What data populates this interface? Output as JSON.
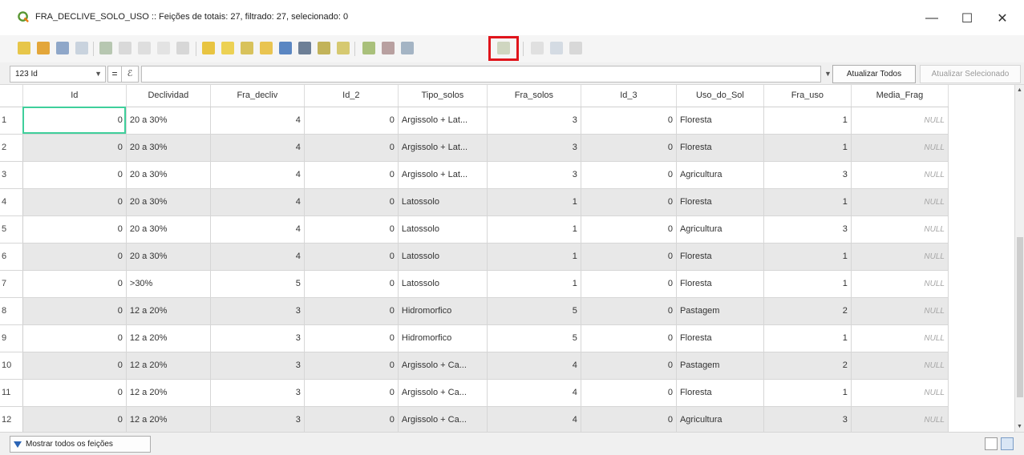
{
  "window": {
    "title": "FRA_DECLIVE_SOLO_USO :: Feições de totais: 27, filtrado: 27, selecionado: 0",
    "minimize": "—",
    "maximize": "☐",
    "close": "✕"
  },
  "filter": {
    "field_label": "123 Id",
    "eq_symbol": "=",
    "expr_symbol": "ℰ",
    "update_all": "Atualizar Todos",
    "update_selected": "Atualizar Selecionado"
  },
  "columns": [
    "Id",
    "Declividad",
    "Fra_decliv",
    "Id_2",
    "Tipo_solos",
    "Fra_solos",
    "Id_3",
    "Uso_do_Sol",
    "Fra_uso",
    "Media_Frag"
  ],
  "rows": [
    {
      "n": "1",
      "id": "0",
      "declividad": "20 a 30%",
      "fra_decliv": "4",
      "id_2": "0",
      "tipo_solos": "Argissolo + Lat...",
      "fra_solos": "3",
      "id_3": "0",
      "uso_do_sol": "Floresta",
      "fra_uso": "1",
      "media_frag": "NULL"
    },
    {
      "n": "2",
      "id": "0",
      "declividad": "20 a 30%",
      "fra_decliv": "4",
      "id_2": "0",
      "tipo_solos": "Argissolo + Lat...",
      "fra_solos": "3",
      "id_3": "0",
      "uso_do_sol": "Floresta",
      "fra_uso": "1",
      "media_frag": "NULL"
    },
    {
      "n": "3",
      "id": "0",
      "declividad": "20 a 30%",
      "fra_decliv": "4",
      "id_2": "0",
      "tipo_solos": "Argissolo + Lat...",
      "fra_solos": "3",
      "id_3": "0",
      "uso_do_sol": "Agricultura",
      "fra_uso": "3",
      "media_frag": "NULL"
    },
    {
      "n": "4",
      "id": "0",
      "declividad": "20 a 30%",
      "fra_decliv": "4",
      "id_2": "0",
      "tipo_solos": "Latossolo",
      "fra_solos": "1",
      "id_3": "0",
      "uso_do_sol": "Floresta",
      "fra_uso": "1",
      "media_frag": "NULL"
    },
    {
      "n": "5",
      "id": "0",
      "declividad": "20 a 30%",
      "fra_decliv": "4",
      "id_2": "0",
      "tipo_solos": "Latossolo",
      "fra_solos": "1",
      "id_3": "0",
      "uso_do_sol": "Agricultura",
      "fra_uso": "3",
      "media_frag": "NULL"
    },
    {
      "n": "6",
      "id": "0",
      "declividad": "20 a 30%",
      "fra_decliv": "4",
      "id_2": "0",
      "tipo_solos": "Latossolo",
      "fra_solos": "1",
      "id_3": "0",
      "uso_do_sol": "Floresta",
      "fra_uso": "1",
      "media_frag": "NULL"
    },
    {
      "n": "7",
      "id": "0",
      "declividad": ">30%",
      "fra_decliv": "5",
      "id_2": "0",
      "tipo_solos": "Latossolo",
      "fra_solos": "1",
      "id_3": "0",
      "uso_do_sol": "Floresta",
      "fra_uso": "1",
      "media_frag": "NULL"
    },
    {
      "n": "8",
      "id": "0",
      "declividad": "12 a 20%",
      "fra_decliv": "3",
      "id_2": "0",
      "tipo_solos": "Hidromorfico",
      "fra_solos": "5",
      "id_3": "0",
      "uso_do_sol": "Pastagem",
      "fra_uso": "2",
      "media_frag": "NULL"
    },
    {
      "n": "9",
      "id": "0",
      "declividad": "12 a 20%",
      "fra_decliv": "3",
      "id_2": "0",
      "tipo_solos": "Hidromorfico",
      "fra_solos": "5",
      "id_3": "0",
      "uso_do_sol": "Floresta",
      "fra_uso": "1",
      "media_frag": "NULL"
    },
    {
      "n": "10",
      "id": "0",
      "declividad": "12 a 20%",
      "fra_decliv": "3",
      "id_2": "0",
      "tipo_solos": "Argissolo + Ca...",
      "fra_solos": "4",
      "id_3": "0",
      "uso_do_sol": "Pastagem",
      "fra_uso": "2",
      "media_frag": "NULL"
    },
    {
      "n": "11",
      "id": "0",
      "declividad": "12 a 20%",
      "fra_decliv": "3",
      "id_2": "0",
      "tipo_solos": "Argissolo + Ca...",
      "fra_solos": "4",
      "id_3": "0",
      "uso_do_sol": "Floresta",
      "fra_uso": "1",
      "media_frag": "NULL"
    },
    {
      "n": "12",
      "id": "0",
      "declividad": "12 a 20%",
      "fra_decliv": "3",
      "id_2": "0",
      "tipo_solos": "Argissolo + Ca...",
      "fra_solos": "4",
      "id_3": "0",
      "uso_do_sol": "Agricultura",
      "fra_uso": "3",
      "media_frag": "NULL"
    }
  ],
  "bottom": {
    "show_features": "Mostrar todos os feições"
  },
  "toolbar_icons": [
    "toggle-edit-icon",
    "multi-edit-icon",
    "save-edits-icon",
    "reload-icon",
    "add-feature-icon",
    "delete-feature-icon",
    "cut-icon",
    "copy-icon",
    "paste-icon",
    "expression-select-icon",
    "select-all-icon",
    "invert-selection-icon",
    "deselect-icon",
    "filter-selected-icon",
    "move-selection-top-icon",
    "pan-to-selection-icon",
    "zoom-to-selection-icon",
    "new-field-icon",
    "delete-field-icon",
    "organize-columns-icon",
    "field-calculator-icon",
    "conditional-format-icon",
    "dock-table-icon",
    "actions-icon"
  ],
  "colors": {
    "highlight": "#e0141b",
    "selected_cell": "#3fcf9b",
    "alt_row": "#e8e8e8"
  }
}
